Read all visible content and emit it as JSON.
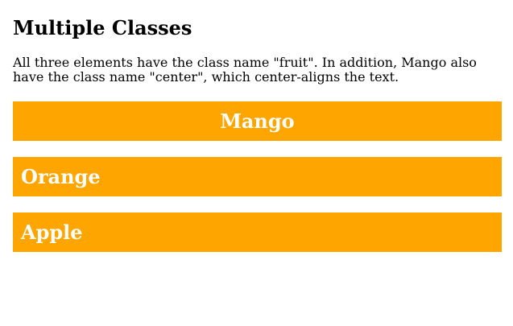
{
  "heading": "Multiple Classes",
  "description": "All three elements have the class name \"fruit\". In addition, Mango also have the class name \"center\", which center-aligns the text.",
  "fruits": [
    {
      "label": "Mango",
      "align": "center"
    },
    {
      "label": "Orange",
      "align": "left"
    },
    {
      "label": "Apple",
      "align": "left"
    }
  ],
  "colors": {
    "fruit_background": "#FFA500",
    "fruit_text": "#FFFFFF",
    "page_background": "#FFFFFF"
  }
}
